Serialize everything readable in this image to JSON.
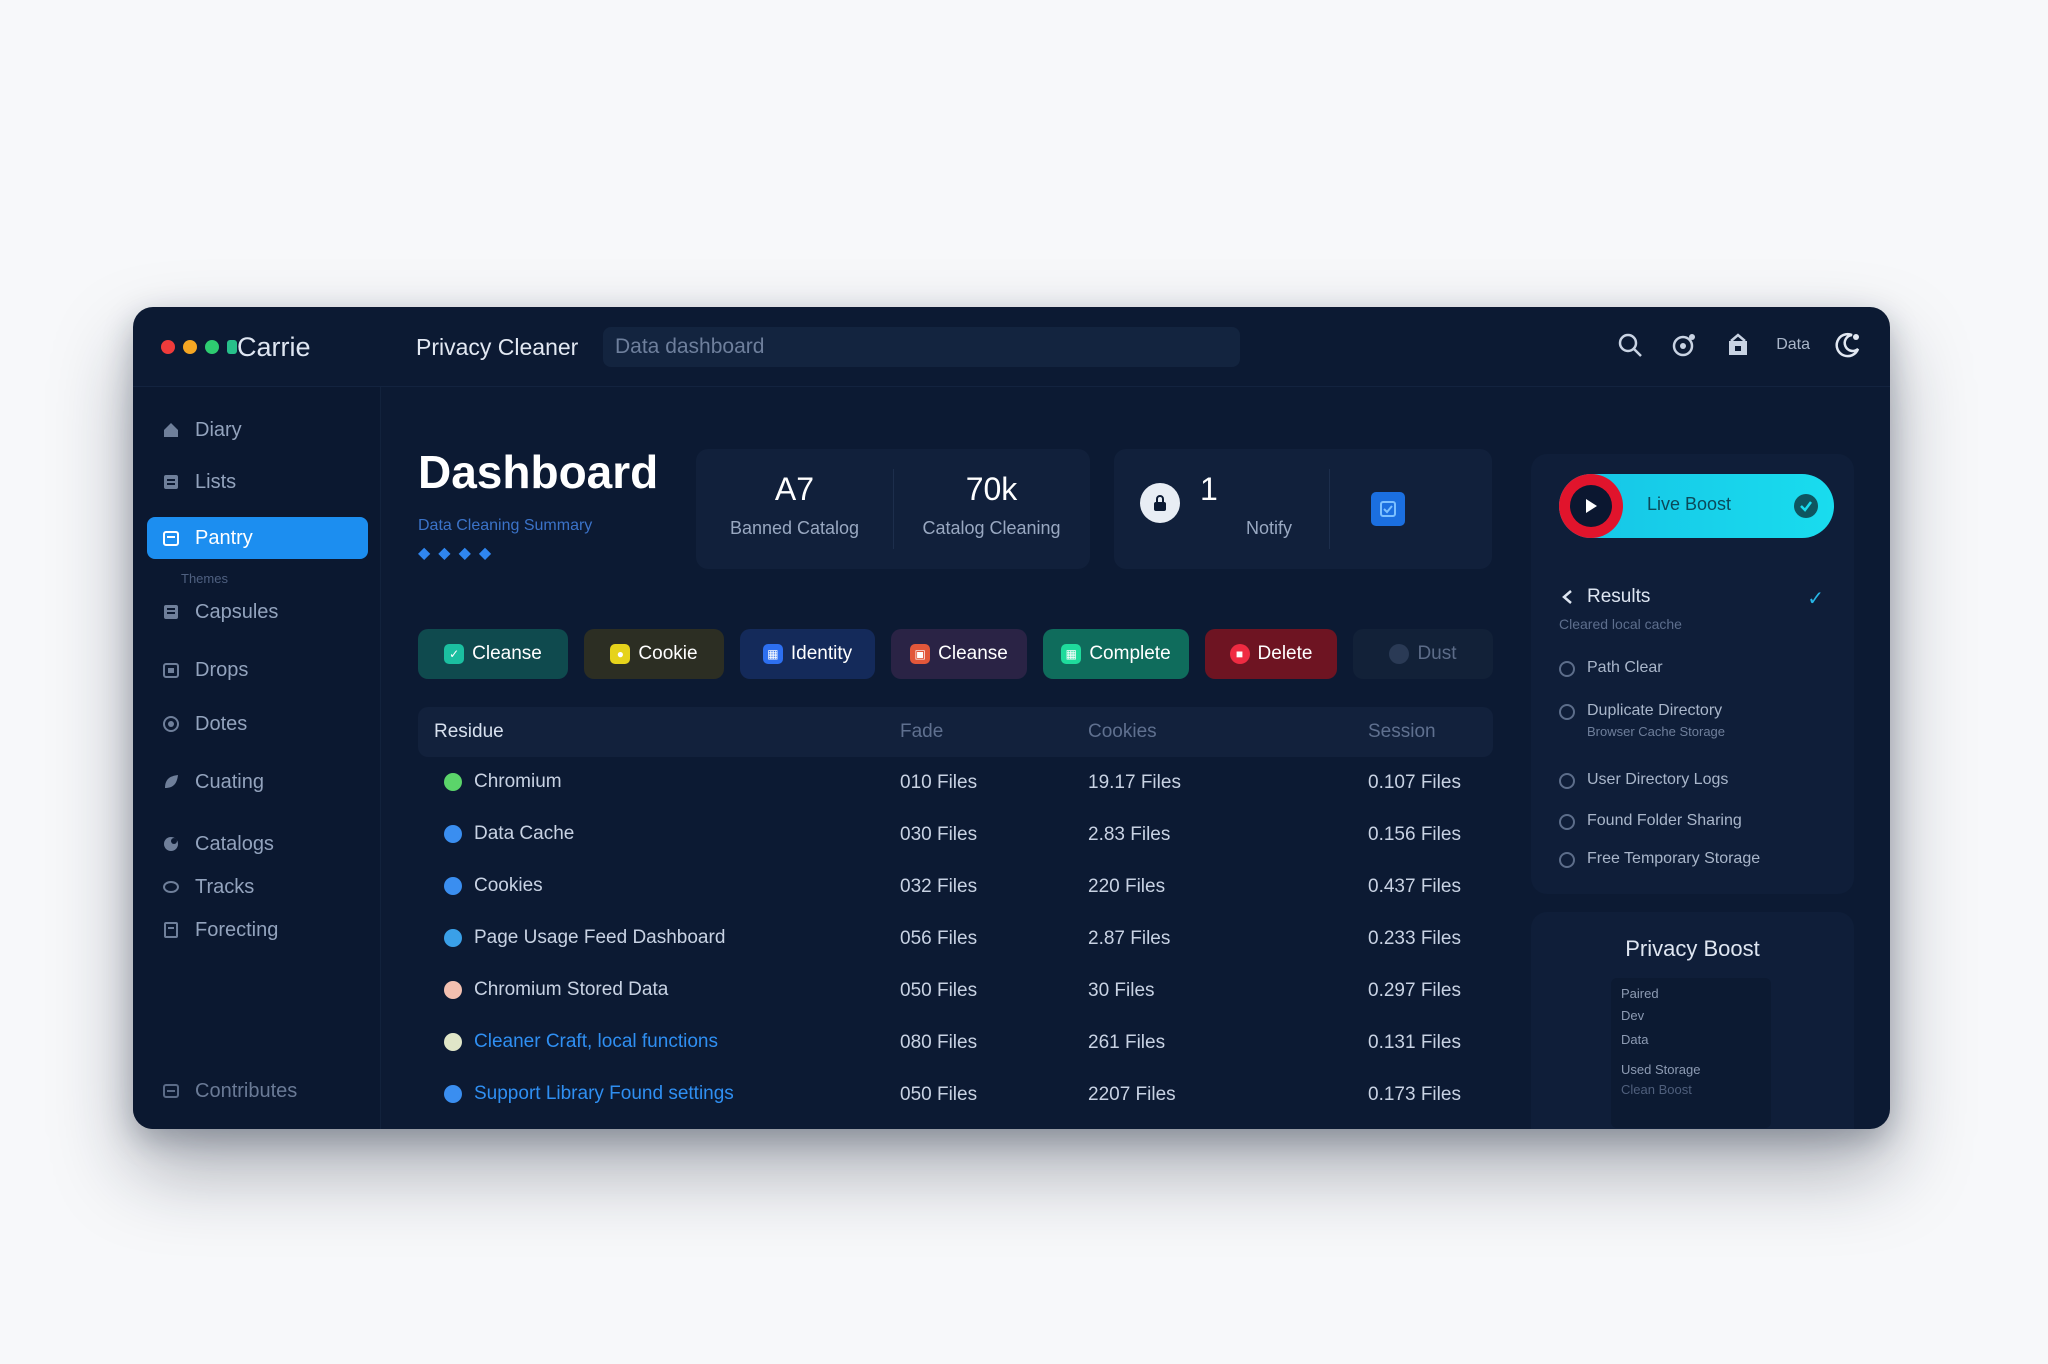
{
  "window": {
    "app_title": "Carrie",
    "breadcrumb": "Privacy Cleaner",
    "search_placeholder": "Data dashboard",
    "user_label": "Data",
    "traffic_lights": [
      "#ef3b3b",
      "#f5a623",
      "#2ecc71",
      "#27c08a"
    ]
  },
  "sidebar": {
    "items": [
      {
        "label": "Diary",
        "icon": "home-icon"
      },
      {
        "label": "Lists",
        "icon": "list-icon"
      },
      {
        "label": "Pantry",
        "icon": "calendar-icon",
        "active": true
      },
      {
        "label": "Capsules",
        "icon": "grid-icon"
      },
      {
        "label": "Drops",
        "icon": "box-icon"
      },
      {
        "label": "Dotes",
        "icon": "dot-icon"
      },
      {
        "label": "Cuating",
        "icon": "leaf-icon"
      },
      {
        "label": "Catalogs",
        "icon": "circle-icon"
      },
      {
        "label": "Tracks",
        "icon": "track-icon"
      },
      {
        "label": "Forecting",
        "icon": "doc-icon"
      }
    ],
    "sub_label": "Themes",
    "footer_label": "Contributes"
  },
  "main": {
    "title": "Dashboard",
    "subtitle": "Data Cleaning Summary",
    "stars": "◆◆◆◆",
    "stats": [
      {
        "value": "A7",
        "label": "Banned Catalog"
      },
      {
        "value": "70k",
        "label": "Catalog Cleaning"
      }
    ],
    "stat2": {
      "value": "1",
      "label": "Notify"
    },
    "chips": [
      {
        "label": "Cleanse",
        "bg": "#0f4a4e",
        "icon_bg": "#1bbfa0"
      },
      {
        "label": "Cookie",
        "bg": "#2c2e23",
        "icon_bg": "#e6d31b"
      },
      {
        "label": "Identity",
        "bg": "#142a5a",
        "icon_bg": "#2d6ff0"
      },
      {
        "label": "Cleanse",
        "bg": "#2a2345",
        "icon_bg": "#e2573a"
      },
      {
        "label": "Complete",
        "bg": "#0f6c5c",
        "icon_bg": "#1fdb9c"
      },
      {
        "label": "Delete",
        "bg": "#6e1422",
        "icon_bg": "#ef2b42"
      },
      {
        "label": "Dust",
        "bg": "#122138",
        "icon_bg": "#2a3a55"
      }
    ],
    "table": {
      "headers": [
        "Residue",
        "Fade",
        "Cookies",
        "Session"
      ],
      "rows": [
        {
          "name": "Chromium",
          "c1": "010 Files",
          "c2": "19.17 Files",
          "c3": "0.107 Files",
          "icon": "#5bd46a",
          "blue": false
        },
        {
          "name": "Data Cache",
          "c1": "030 Files",
          "c2": "2.83 Files",
          "c3": "0.156 Files",
          "icon": "#3a8ef0",
          "blue": false
        },
        {
          "name": "Cookies",
          "c1": "032 Files",
          "c2": "220 Files",
          "c3": "0.437 Files",
          "icon": "#3a8ef0",
          "blue": false
        },
        {
          "name": "Page Usage Feed Dashboard",
          "c1": "056 Files",
          "c2": "2.87 Files",
          "c3": "0.233 Files",
          "icon": "#3aa0e8",
          "blue": false
        },
        {
          "name": "Chromium Stored Data",
          "c1": "050 Files",
          "c2": "30 Files",
          "c3": "0.297 Files",
          "icon": "#f3c0b0",
          "blue": false
        },
        {
          "name": "Cleaner Craft, local functions",
          "c1": "080 Files",
          "c2": "261 Files",
          "c3": "0.131 Files",
          "icon": "#e0e6c8",
          "blue": true
        },
        {
          "name": "Support Library Found settings",
          "c1": "050 Files",
          "c2": "2207 Files",
          "c3": "0.173 Files",
          "icon": "#3a8ef0",
          "blue": true
        }
      ]
    }
  },
  "right_panel": {
    "cta_label": "Live Boost",
    "list_head": "Results",
    "list_head_sub": "Cleared local cache",
    "items": [
      {
        "title": "Path Clear",
        "sub": ""
      },
      {
        "title": "Duplicate Directory",
        "sub": "Browser Cache Storage"
      },
      {
        "title": "User Directory Logs",
        "sub": ""
      },
      {
        "title": "Found Folder Sharing",
        "sub": ""
      },
      {
        "title": "Free Temporary Storage",
        "sub": ""
      }
    ]
  },
  "summary_card": {
    "title": "Privacy Boost",
    "lines": [
      "Paired",
      "Dev",
      "Data",
      "Used Storage",
      "Clean Boost"
    ]
  }
}
